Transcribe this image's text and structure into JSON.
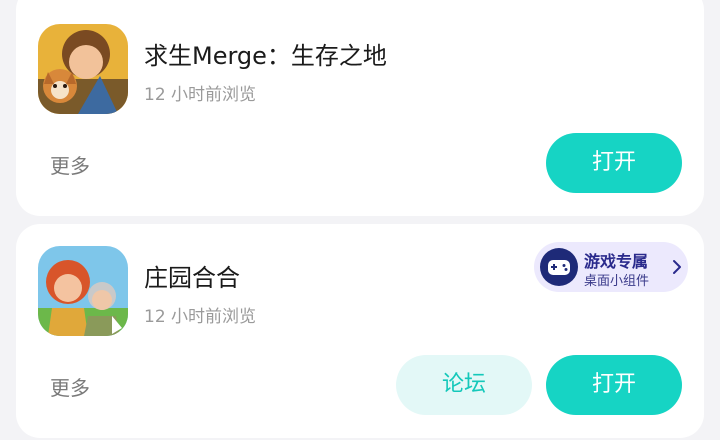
{
  "apps": [
    {
      "name": "求生Merge：生存之地",
      "meta": "12 小时前浏览",
      "more_label": "更多",
      "open_label": "打开"
    },
    {
      "name": "庄园合合",
      "meta": "12 小时前浏览",
      "more_label": "更多",
      "forum_label": "论坛",
      "open_label": "打开",
      "widget": {
        "title": "游戏专属",
        "subtitle": "桌面小组件"
      }
    }
  ],
  "colors": {
    "accent": "#16d4c4",
    "forum_bg": "#e3f8f7",
    "widget_bg": "#ece9fd",
    "widget_text": "#2a2a8c"
  },
  "icons": {
    "app1": "survival-merge-app-icon",
    "app2": "manor-merge-app-icon",
    "widget": "gamepad-icon",
    "chevron": "chevron-right-icon"
  }
}
